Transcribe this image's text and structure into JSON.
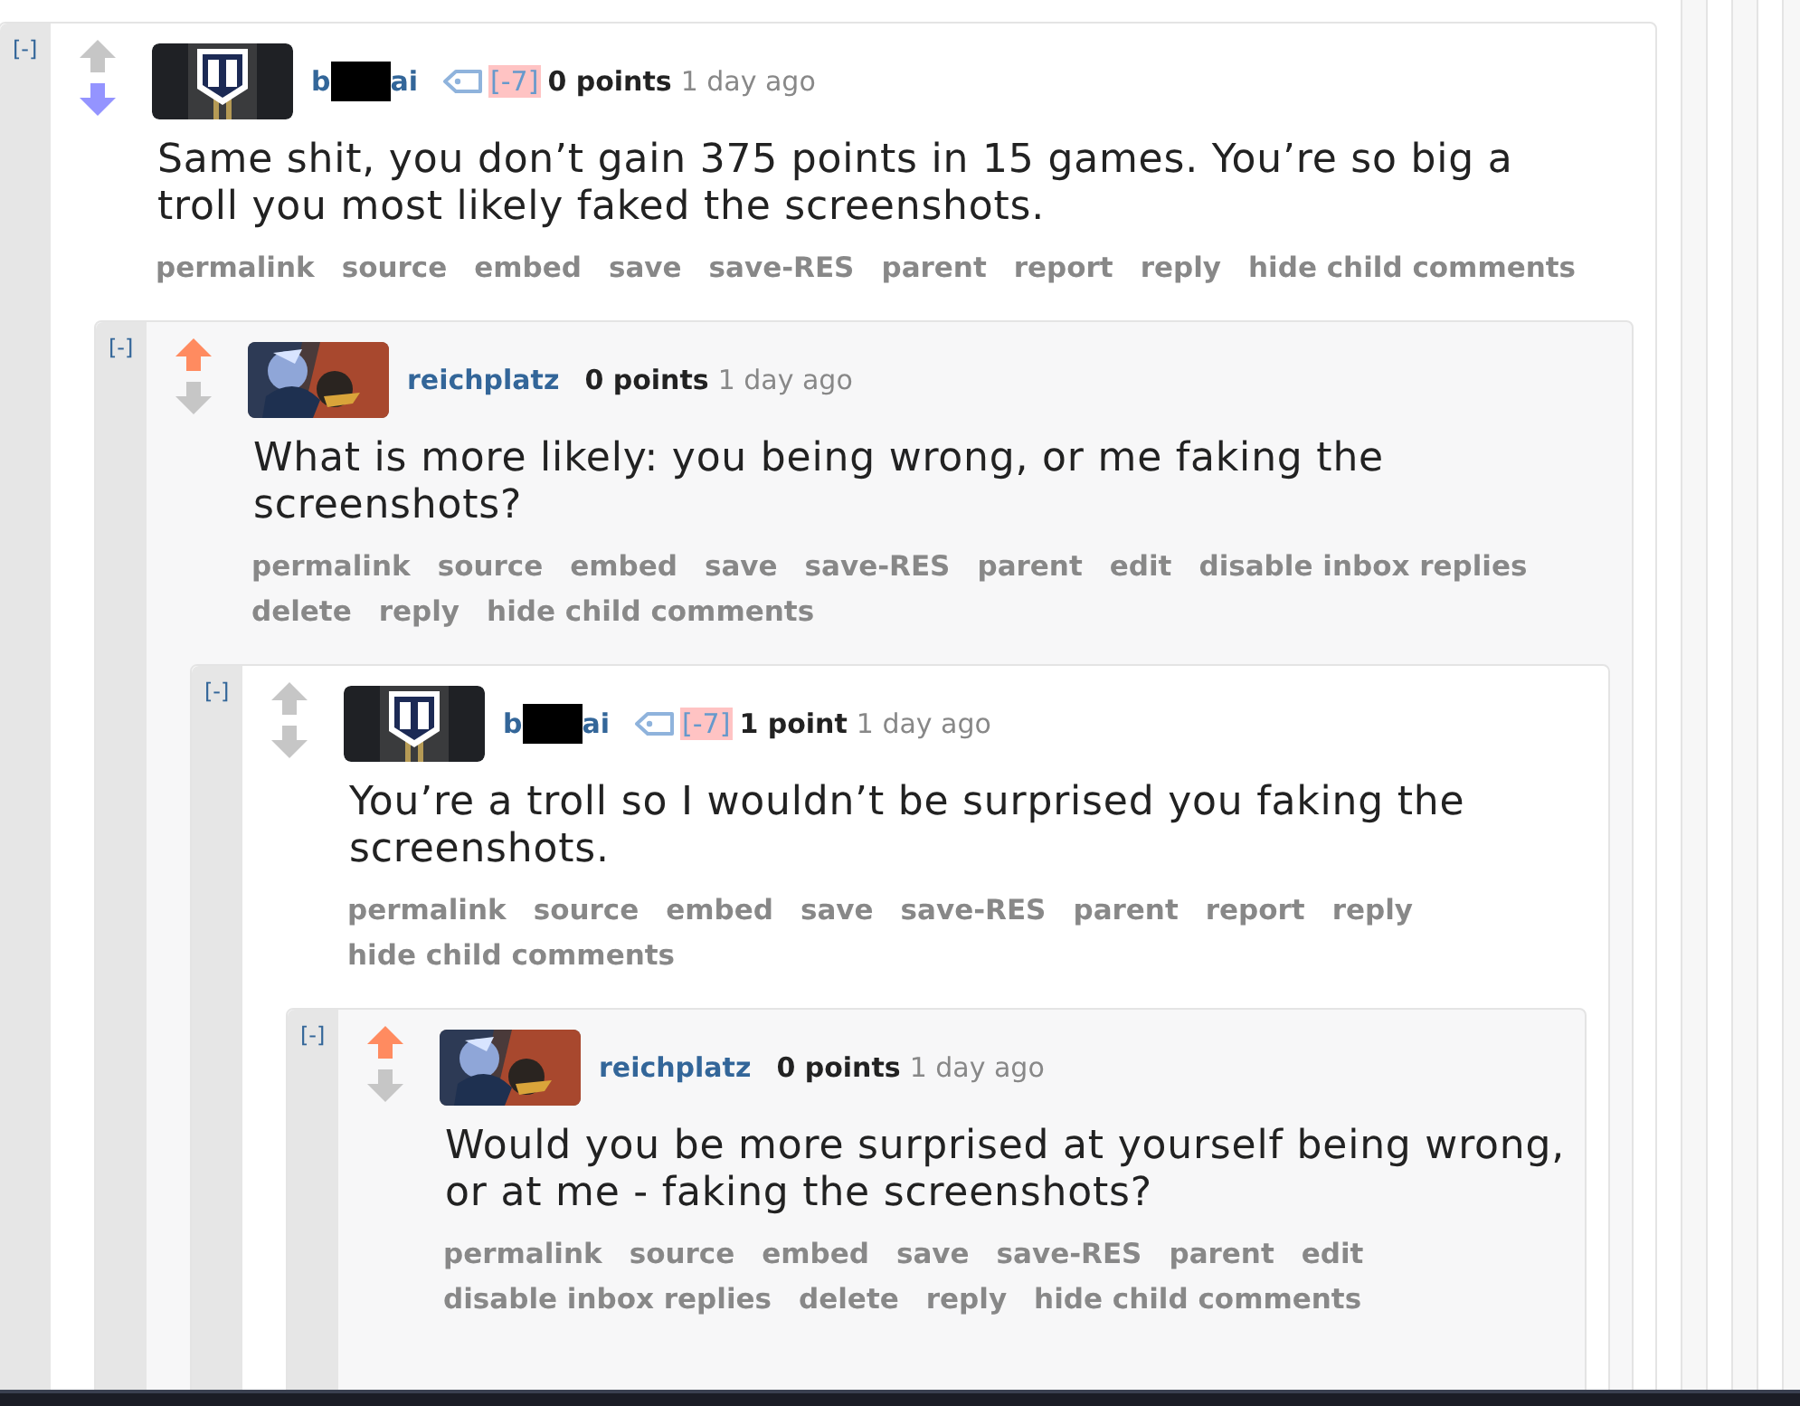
{
  "comments": [
    {
      "collapse": "[-]",
      "upvoted": false,
      "downvoted": true,
      "author": {
        "start": "b",
        "end": "ai",
        "redacted": true
      },
      "tag": true,
      "vote_weight": "[-7]",
      "score": "0 points",
      "time": "1 day ago",
      "body": "Same shit, you don’t gain 375 points in 15 games. You’re so big a troll you most likely faked the screenshots.",
      "buttons": [
        "permalink",
        "source",
        "embed",
        "save",
        "save-RES",
        "parent",
        "report",
        "reply",
        "hide child comments"
      ]
    },
    {
      "collapse": "[-]",
      "upvoted": true,
      "downvoted": false,
      "author": {
        "start": "reichplatz",
        "redacted": false
      },
      "tag": false,
      "score": "0 points",
      "time": "1 day ago",
      "body": "What is more likely: you being wrong, or me faking the screenshots?",
      "buttons": [
        "permalink",
        "source",
        "embed",
        "save",
        "save-RES",
        "parent",
        "edit",
        "disable inbox replies",
        "delete",
        "reply",
        "hide child comments"
      ]
    },
    {
      "collapse": "[-]",
      "upvoted": false,
      "downvoted": false,
      "author": {
        "start": "b",
        "end": "ai",
        "redacted": true
      },
      "tag": true,
      "vote_weight": "[-7]",
      "score": "1 point",
      "time": "1 day ago",
      "body": "You’re a troll so I wouldn’t be surprised you faking the screenshots.",
      "buttons": [
        "permalink",
        "source",
        "embed",
        "save",
        "save-RES",
        "parent",
        "report",
        "reply",
        "hide child comments"
      ]
    },
    {
      "collapse": "[-]",
      "upvoted": true,
      "downvoted": false,
      "author": {
        "start": "reichplatz",
        "redacted": false
      },
      "tag": false,
      "score": "0 points",
      "time": "1 day ago",
      "body": "Would you be more surprised at yourself being wrong, or at me - faking the screenshots?",
      "buttons": [
        "permalink",
        "source",
        "embed",
        "save",
        "save-RES",
        "parent",
        "edit",
        "disable inbox replies",
        "delete",
        "reply",
        "hide child comments"
      ]
    }
  ]
}
